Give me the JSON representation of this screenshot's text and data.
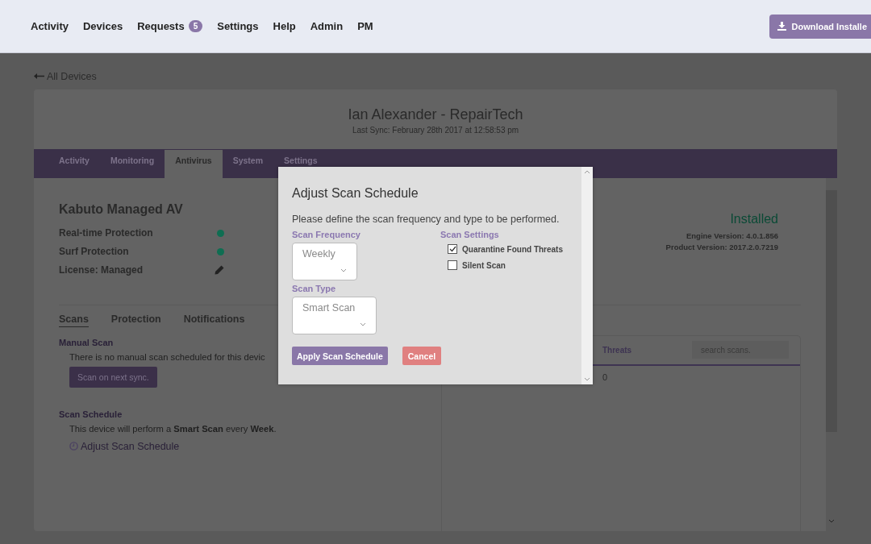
{
  "nav": {
    "items": [
      {
        "label": "Activity"
      },
      {
        "label": "Devices"
      },
      {
        "label": "Requests",
        "badge": "5"
      },
      {
        "label": "Settings"
      },
      {
        "label": "Help"
      },
      {
        "label": "Admin"
      },
      {
        "label": "PM"
      }
    ],
    "download_button": "Download Installe"
  },
  "back_link": "All Devices",
  "device": {
    "title": "Ian Alexander - RepairTech",
    "last_sync": "Last Sync: February 28th 2017 at 12:58:53 pm"
  },
  "tabs": [
    {
      "label": "Activity",
      "selected": false
    },
    {
      "label": "Monitoring",
      "selected": false
    },
    {
      "label": "Antivirus",
      "selected": true
    },
    {
      "label": "System",
      "selected": false
    },
    {
      "label": "Settings",
      "selected": false
    }
  ],
  "av": {
    "title": "Kabuto Managed AV",
    "rows": [
      {
        "kind": "status",
        "label": "Real-time Protection",
        "color": "#0f6e52"
      },
      {
        "kind": "status",
        "label": "Surf Protection",
        "color": "#0f6e52"
      },
      {
        "kind": "edit",
        "label": "License: Managed"
      }
    ],
    "status": "Installed",
    "engine_version": "Engine Version: 4.0.1.856",
    "product_version": "Product Version: 2017.2.0.7219"
  },
  "subtabs": [
    {
      "label": "Scans",
      "selected": true
    },
    {
      "label": "Protection",
      "selected": false
    },
    {
      "label": "Notifications",
      "selected": false
    }
  ],
  "manual_scan": {
    "heading": "Manual Scan",
    "text": "There is no manual scan scheduled for this devic",
    "button": "Scan on next sync."
  },
  "schedule": {
    "heading": "Scan Schedule",
    "text": "This device will perform a **Smart Scan** every **Week**.",
    "link": "Adjust Scan Schedule"
  },
  "scans_table": {
    "columns": [
      "Threats"
    ],
    "search": {
      "placeholder": "search scans."
    },
    "rows": [
      [
        "0"
      ]
    ]
  },
  "modal": {
    "title": "Adjust Scan Schedule",
    "description": "Please define the scan frequency and type to be performed.",
    "frequency": {
      "label": "Scan Frequency",
      "value": "Weekly"
    },
    "type": {
      "label": "Scan Type",
      "value": "Smart Scan"
    },
    "settings_label": "Scan Settings",
    "settings": [
      {
        "label": "Quarantine Found Threats",
        "checked": true
      },
      {
        "label": "Silent Scan",
        "checked": false
      }
    ],
    "apply_button": "Apply Scan Schedule",
    "cancel_button": "Cancel"
  }
}
